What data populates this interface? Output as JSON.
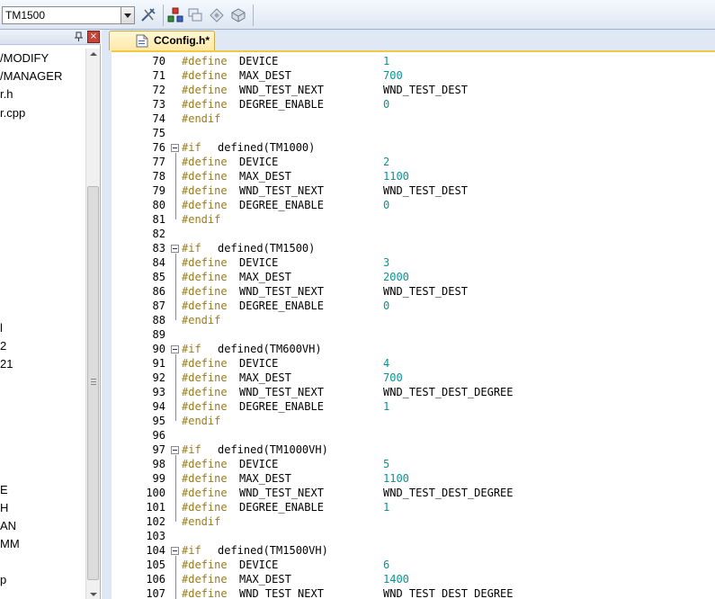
{
  "toolbar": {
    "config_combo_value": "TM1500",
    "icons": [
      "wrench-icon",
      "class-wizard-icon",
      "window-icon",
      "diamond-icon",
      "disk-icon"
    ]
  },
  "left_pane": {
    "items": [
      "/MODIFY",
      "/MANAGER",
      "r.h",
      "r.cpp",
      "l",
      "2",
      "21",
      "E",
      "H",
      "AN",
      "MM",
      "p"
    ]
  },
  "tab": {
    "label": "CConfig.h*"
  },
  "colors": {
    "keyword": "#9a7b1c",
    "number": "#089494",
    "tab_active": "#ffe9a6"
  },
  "code": {
    "lines": [
      {
        "n": "70",
        "kw": "#define",
        "name": "DEVICE",
        "value": "1",
        "vtype": "num"
      },
      {
        "n": "71",
        "kw": "#define",
        "name": "MAX_DEST",
        "value": "700",
        "vtype": "num"
      },
      {
        "n": "72",
        "kw": "#define",
        "name": "WND_TEST_NEXT",
        "value": "WND_TEST_DEST",
        "vtype": "val"
      },
      {
        "n": "73",
        "kw": "#define",
        "name": "DEGREE_ENABLE",
        "value": "0",
        "vtype": "num"
      },
      {
        "n": "74",
        "kw": "#endif",
        "name": "",
        "value": "",
        "vtype": ""
      },
      {
        "n": "75",
        "kw": "",
        "name": "",
        "value": "",
        "vtype": ""
      },
      {
        "n": "76",
        "kw": "#if",
        "name": "defined(TM1000)",
        "value": "",
        "vtype": "",
        "fold": true
      },
      {
        "n": "77",
        "kw": "#define",
        "name": "DEVICE",
        "value": "2",
        "vtype": "num"
      },
      {
        "n": "78",
        "kw": "#define",
        "name": "MAX_DEST",
        "value": "1100",
        "vtype": "num"
      },
      {
        "n": "79",
        "kw": "#define",
        "name": "WND_TEST_NEXT",
        "value": "WND_TEST_DEST",
        "vtype": "val"
      },
      {
        "n": "80",
        "kw": "#define",
        "name": "DEGREE_ENABLE",
        "value": "0",
        "vtype": "num"
      },
      {
        "n": "81",
        "kw": "#endif",
        "name": "",
        "value": "",
        "vtype": ""
      },
      {
        "n": "82",
        "kw": "",
        "name": "",
        "value": "",
        "vtype": ""
      },
      {
        "n": "83",
        "kw": "#if",
        "name": "defined(TM1500)",
        "value": "",
        "vtype": "",
        "fold": true
      },
      {
        "n": "84",
        "kw": "#define",
        "name": "DEVICE",
        "value": "3",
        "vtype": "num"
      },
      {
        "n": "85",
        "kw": "#define",
        "name": "MAX_DEST",
        "value": "2000",
        "vtype": "num"
      },
      {
        "n": "86",
        "kw": "#define",
        "name": "WND_TEST_NEXT",
        "value": "WND_TEST_DEST",
        "vtype": "val"
      },
      {
        "n": "87",
        "kw": "#define",
        "name": "DEGREE_ENABLE",
        "value": "0",
        "vtype": "num"
      },
      {
        "n": "88",
        "kw": "#endif",
        "name": "",
        "value": "",
        "vtype": ""
      },
      {
        "n": "89",
        "kw": "",
        "name": "",
        "value": "",
        "vtype": ""
      },
      {
        "n": "90",
        "kw": "#if",
        "name": "defined(TM600VH)",
        "value": "",
        "vtype": "",
        "fold": true
      },
      {
        "n": "91",
        "kw": "#define",
        "name": "DEVICE",
        "value": "4",
        "vtype": "num"
      },
      {
        "n": "92",
        "kw": "#define",
        "name": "MAX_DEST",
        "value": "700",
        "vtype": "num"
      },
      {
        "n": "93",
        "kw": "#define",
        "name": "WND_TEST_NEXT",
        "value": "WND_TEST_DEST_DEGREE",
        "vtype": "val"
      },
      {
        "n": "94",
        "kw": "#define",
        "name": "DEGREE_ENABLE",
        "value": "1",
        "vtype": "num"
      },
      {
        "n": "95",
        "kw": "#endif",
        "name": "",
        "value": "",
        "vtype": ""
      },
      {
        "n": "96",
        "kw": "",
        "name": "",
        "value": "",
        "vtype": ""
      },
      {
        "n": "97",
        "kw": "#if",
        "name": "defined(TM1000VH)",
        "value": "",
        "vtype": "",
        "fold": true
      },
      {
        "n": "98",
        "kw": "#define",
        "name": "DEVICE",
        "value": "5",
        "vtype": "num"
      },
      {
        "n": "99",
        "kw": "#define",
        "name": "MAX_DEST",
        "value": "1100",
        "vtype": "num"
      },
      {
        "n": "100",
        "kw": "#define",
        "name": "WND_TEST_NEXT",
        "value": "WND_TEST_DEST_DEGREE",
        "vtype": "val"
      },
      {
        "n": "101",
        "kw": "#define",
        "name": "DEGREE_ENABLE",
        "value": "1",
        "vtype": "num"
      },
      {
        "n": "102",
        "kw": "#endif",
        "name": "",
        "value": "",
        "vtype": ""
      },
      {
        "n": "103",
        "kw": "",
        "name": "",
        "value": "",
        "vtype": ""
      },
      {
        "n": "104",
        "kw": "#if",
        "name": "defined(TM1500VH)",
        "value": "",
        "vtype": "",
        "fold": true
      },
      {
        "n": "105",
        "kw": "#define",
        "name": "DEVICE",
        "value": "6",
        "vtype": "num"
      },
      {
        "n": "106",
        "kw": "#define",
        "name": "MAX_DEST",
        "value": "1400",
        "vtype": "num"
      },
      {
        "n": "107",
        "kw": "#define",
        "name": "WND_TEST_NEXT",
        "value": "WND_TEST_DEST_DEGREE",
        "vtype": "val"
      }
    ]
  }
}
